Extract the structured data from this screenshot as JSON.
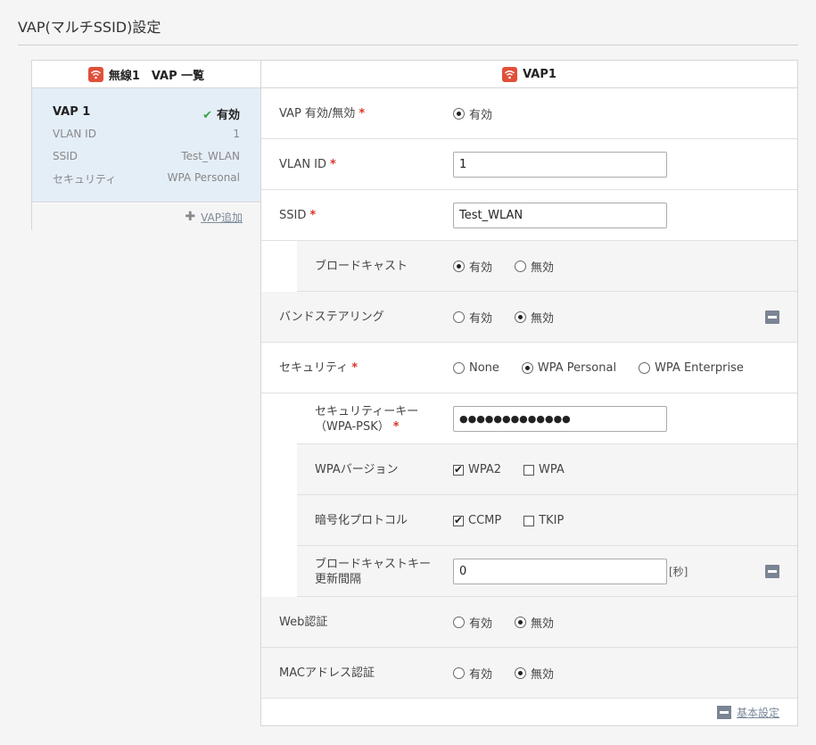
{
  "page": {
    "title": "VAP(マルチSSID)設定"
  },
  "left": {
    "header": "無線1　VAP 一覧",
    "card": {
      "name": "VAP 1",
      "status": "有効",
      "rows": [
        {
          "key": "VLAN ID",
          "value": "1"
        },
        {
          "key": "SSID",
          "value": "Test_WLAN"
        },
        {
          "key": "セキュリティ",
          "value": "WPA Personal"
        }
      ]
    },
    "add_label": "VAP追加"
  },
  "right": {
    "header": "VAP1",
    "vap_enable": {
      "label": "VAP 有効/無効",
      "options": [
        "有効"
      ],
      "selected": "有効"
    },
    "vlan_id": {
      "label": "VLAN ID",
      "value": "1"
    },
    "ssid": {
      "label": "SSID",
      "value": "Test_WLAN"
    },
    "broadcast": {
      "label": "ブロードキャスト",
      "options": [
        "有効",
        "無効"
      ],
      "selected": "有効"
    },
    "band_steering": {
      "label": "バンドステアリング",
      "options": [
        "有効",
        "無効"
      ],
      "selected": "無効"
    },
    "security": {
      "label": "セキュリティ",
      "options": [
        "None",
        "WPA Personal",
        "WPA Enterprise"
      ],
      "selected": "WPA Personal"
    },
    "security_key": {
      "label_line1": "セキュリティーキー",
      "label_line2": "（WPA-PSK）",
      "value": "●●●●●●●●●●●●●"
    },
    "wpa_version": {
      "label": "WPAバージョン",
      "options": [
        "WPA2",
        "WPA"
      ],
      "checked": [
        "WPA2"
      ]
    },
    "encryption": {
      "label": "暗号化プロトコル",
      "options": [
        "CCMP",
        "TKIP"
      ],
      "checked": [
        "CCMP"
      ]
    },
    "broadcast_key": {
      "label_line1": "ブロードキャストキー",
      "label_line2": "更新間隔",
      "value": "0",
      "unit": "[秒]"
    },
    "web_auth": {
      "label": "Web認証",
      "options": [
        "有効",
        "無効"
      ],
      "selected": "無効"
    },
    "mac_auth": {
      "label": "MACアドレス認証",
      "options": [
        "有効",
        "無効"
      ],
      "selected": "無効"
    },
    "footer_link": "基本設定"
  },
  "colors": {
    "accent_red": "#e0503a",
    "selected_card": "#e4eef7",
    "required": "#d9342b",
    "check_green": "#3aa64b"
  },
  "icons": {
    "wifi": "wifi-icon",
    "check": "check-icon",
    "plus": "plus-icon",
    "collapse": "collapse-icon"
  }
}
